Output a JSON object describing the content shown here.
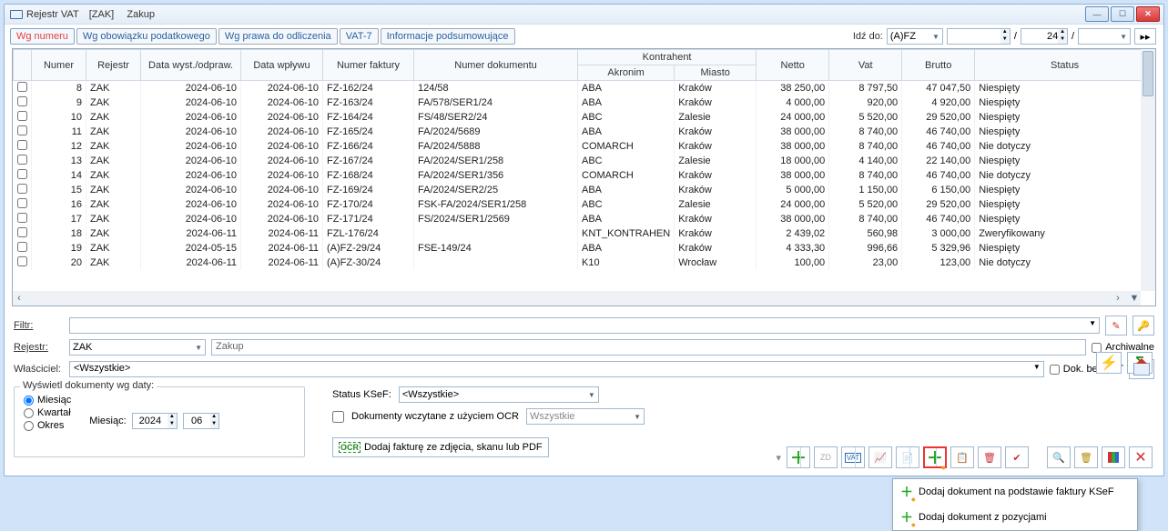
{
  "window": {
    "title": "Rejestr VAT",
    "reg_code": "[ZAK]",
    "reg_name": "Zakup"
  },
  "tabs": [
    "Wg numeru",
    "Wg obowiązku podatkowego",
    "Wg prawa do odliczenia",
    "VAT-7",
    "Informacje podsumowujące"
  ],
  "idz": {
    "label": "Idź do:",
    "select1": "(A)FZ",
    "number": "24"
  },
  "columns": {
    "numer": "Numer",
    "rejestr": "Rejestr",
    "data_wyst": "Data wyst./odpraw.",
    "data_wplywu": "Data wpływu",
    "numer_faktury": "Numer faktury",
    "numer_dokumentu": "Numer dokumentu",
    "kontrahent": "Kontrahent",
    "akronim": "Akronim",
    "miasto": "Miasto",
    "netto": "Netto",
    "vat": "Vat",
    "brutto": "Brutto",
    "status": "Status"
  },
  "rows": [
    {
      "n": "8",
      "r": "ZAK",
      "dw": "2024-06-10",
      "dp": "2024-06-10",
      "nf": "FZ-162/24",
      "nd": "124/58",
      "ak": "ABA",
      "mi": "Kraków",
      "ne": "38 250,00",
      "va": "8 797,50",
      "br": "47 047,50",
      "st": "Niespięty"
    },
    {
      "n": "9",
      "r": "ZAK",
      "dw": "2024-06-10",
      "dp": "2024-06-10",
      "nf": "FZ-163/24",
      "nd": "FA/578/SER1/24",
      "ak": "ABA",
      "mi": "Kraków",
      "ne": "4 000,00",
      "va": "920,00",
      "br": "4 920,00",
      "st": "Niespięty"
    },
    {
      "n": "10",
      "r": "ZAK",
      "dw": "2024-06-10",
      "dp": "2024-06-10",
      "nf": "FZ-164/24",
      "nd": "FS/48/SER2/24",
      "ak": "ABC",
      "mi": "Zalesie",
      "ne": "24 000,00",
      "va": "5 520,00",
      "br": "29 520,00",
      "st": "Niespięty"
    },
    {
      "n": "11",
      "r": "ZAK",
      "dw": "2024-06-10",
      "dp": "2024-06-10",
      "nf": "FZ-165/24",
      "nd": "FA/2024/5689",
      "ak": "ABA",
      "mi": "Kraków",
      "ne": "38 000,00",
      "va": "8 740,00",
      "br": "46 740,00",
      "st": "Niespięty"
    },
    {
      "n": "12",
      "r": "ZAK",
      "dw": "2024-06-10",
      "dp": "2024-06-10",
      "nf": "FZ-166/24",
      "nd": "FA/2024/5888",
      "ak": "COMARCH",
      "mi": "Kraków",
      "ne": "38 000,00",
      "va": "8 740,00",
      "br": "46 740,00",
      "st": "Nie dotyczy"
    },
    {
      "n": "13",
      "r": "ZAK",
      "dw": "2024-06-10",
      "dp": "2024-06-10",
      "nf": "FZ-167/24",
      "nd": "FA/2024/SER1/258",
      "ak": "ABC",
      "mi": "Zalesie",
      "ne": "18 000,00",
      "va": "4 140,00",
      "br": "22 140,00",
      "st": "Niespięty"
    },
    {
      "n": "14",
      "r": "ZAK",
      "dw": "2024-06-10",
      "dp": "2024-06-10",
      "nf": "FZ-168/24",
      "nd": "FA/2024/SER1/356",
      "ak": "COMARCH",
      "mi": "Kraków",
      "ne": "38 000,00",
      "va": "8 740,00",
      "br": "46 740,00",
      "st": "Nie dotyczy"
    },
    {
      "n": "15",
      "r": "ZAK",
      "dw": "2024-06-10",
      "dp": "2024-06-10",
      "nf": "FZ-169/24",
      "nd": "FA/2024/SER2/25",
      "ak": "ABA",
      "mi": "Kraków",
      "ne": "5 000,00",
      "va": "1 150,00",
      "br": "6 150,00",
      "st": "Niespięty"
    },
    {
      "n": "16",
      "r": "ZAK",
      "dw": "2024-06-10",
      "dp": "2024-06-10",
      "nf": "FZ-170/24",
      "nd": "FSK-FA/2024/SER1/258",
      "ak": "ABC",
      "mi": "Zalesie",
      "ne": "24 000,00",
      "va": "5 520,00",
      "br": "29 520,00",
      "st": "Niespięty"
    },
    {
      "n": "17",
      "r": "ZAK",
      "dw": "2024-06-10",
      "dp": "2024-06-10",
      "nf": "FZ-171/24",
      "nd": "FS/2024/SER1/2569",
      "ak": "ABA",
      "mi": "Kraków",
      "ne": "38 000,00",
      "va": "8 740,00",
      "br": "46 740,00",
      "st": "Niespięty"
    },
    {
      "n": "18",
      "r": "ZAK",
      "dw": "2024-06-11",
      "dp": "2024-06-11",
      "nf": "FZL-176/24",
      "nd": "",
      "ak": "KNT_KONTRAHEN",
      "mi": "Kraków",
      "ne": "2 439,02",
      "va": "560,98",
      "br": "3 000,00",
      "st": "Zweryfikowany"
    },
    {
      "n": "19",
      "r": "ZAK",
      "dw": "2024-05-15",
      "dp": "2024-06-11",
      "nf": "(A)FZ-29/24",
      "nd": "FSE-149/24",
      "ak": "ABA",
      "mi": "Kraków",
      "ne": "4 333,30",
      "va": "996,66",
      "br": "5 329,96",
      "st": "Niespięty"
    },
    {
      "n": "20",
      "r": "ZAK",
      "dw": "2024-06-11",
      "dp": "2024-06-11",
      "nf": "(A)FZ-30/24",
      "nd": "",
      "ak": "K10",
      "mi": "Wrocław",
      "ne": "100,00",
      "va": "23,00",
      "br": "123,00",
      "st": "Nie dotyczy"
    }
  ],
  "filter": {
    "label": "Filtr:",
    "rejestr_label": "Rejestr:",
    "rejestr_code": "ZAK",
    "rejestr_name": "Zakup",
    "wlasciciel_label": "Właściciel:",
    "wlasciciel_value": "<Wszystkie>",
    "archiwalne": "Archiwalne",
    "bezvat": "Dok. bez VAT"
  },
  "date_panel": {
    "title": "Wyświetl dokumenty wg daty:",
    "miesiac": "Miesiąc",
    "kwartal": "Kwartał",
    "okres": "Okres",
    "miesiac_lbl": "Miesiąc:",
    "year": "2024",
    "month": "06"
  },
  "ksef": {
    "label": "Status KSeF:",
    "value": "<Wszystkie>",
    "ocr_chk": "Dokumenty wczytane z użyciem OCR",
    "ocr_select": "Wszystkie",
    "ocr_btn": "Dodaj fakturę ze zdjęcia, skanu lub PDF"
  },
  "menu": {
    "item1": "Dodaj dokument na podstawie faktury KSeF",
    "item2": "Dodaj dokument z pozycjami"
  }
}
